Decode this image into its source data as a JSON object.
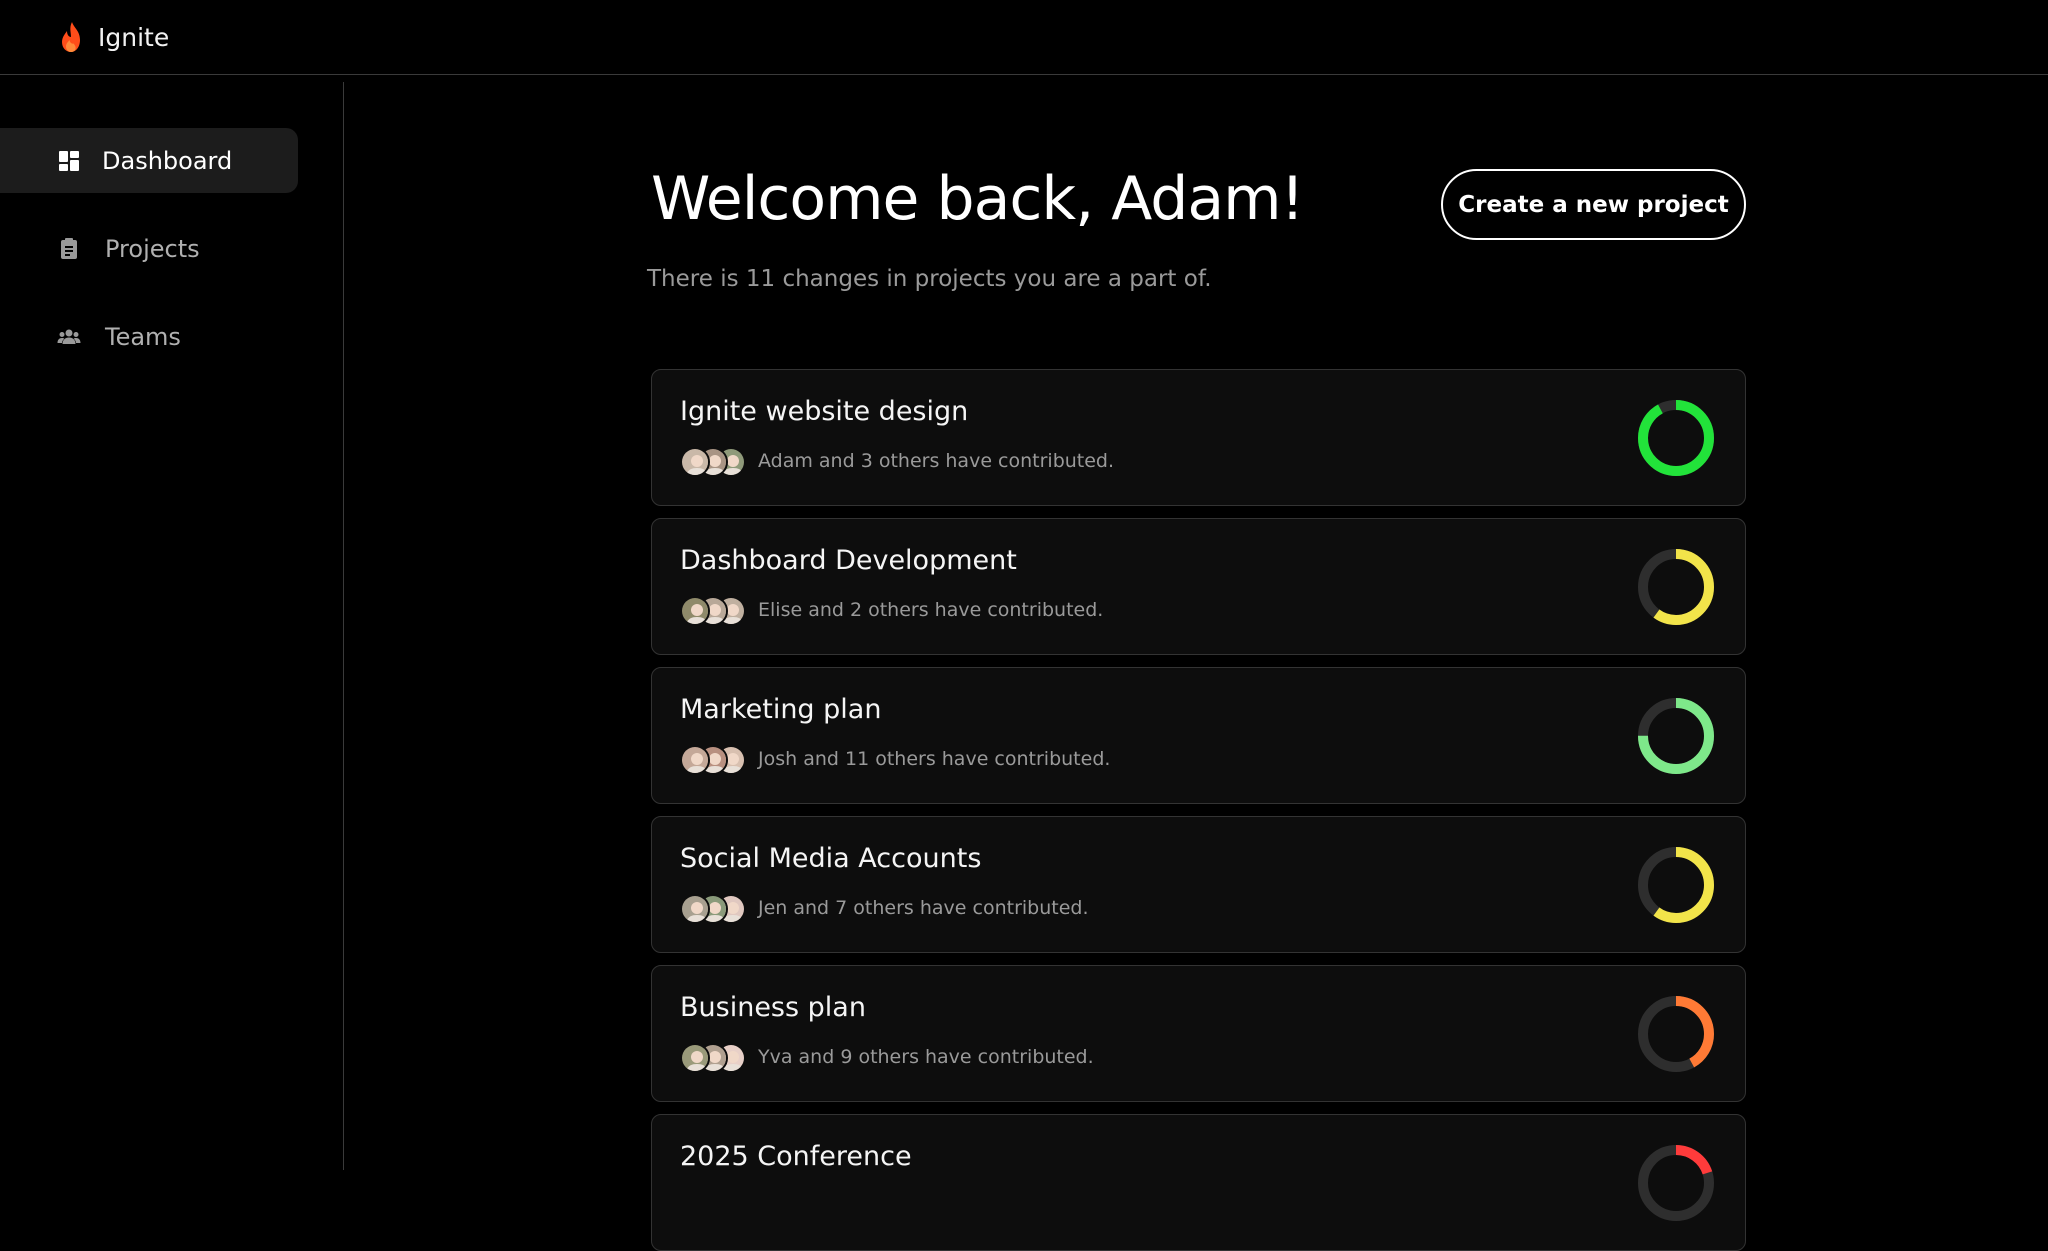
{
  "app": {
    "name": "Ignite",
    "brand_color": "#ff4d1a"
  },
  "sidebar": {
    "items": [
      {
        "label": "Dashboard",
        "icon": "dashboard-icon",
        "active": true
      },
      {
        "label": "Projects",
        "icon": "clipboard-icon",
        "active": false
      },
      {
        "label": "Teams",
        "icon": "users-icon",
        "active": false
      }
    ]
  },
  "main": {
    "welcome": "Welcome back, Adam!",
    "subtitle": "There is 11 changes in projects you are a part of.",
    "create_button": "Create a new project"
  },
  "projects": [
    {
      "title": "Ignite website design",
      "contributors": "Adam and 3 others have contributed.",
      "progress": 0.92,
      "color": "#22e33a"
    },
    {
      "title": "Dashboard Development",
      "contributors": "Elise and 2 others have contributed.",
      "progress": 0.6,
      "color": "#f2e44a"
    },
    {
      "title": "Marketing plan",
      "contributors": "Josh and 11 others have contributed.",
      "progress": 0.75,
      "color": "#7ee88a"
    },
    {
      "title": "Social Media Accounts",
      "contributors": "Jen and 7 others have contributed.",
      "progress": 0.6,
      "color": "#f2e44a"
    },
    {
      "title": "Business plan",
      "contributors": "Yva and 9 others have contributed.",
      "progress": 0.42,
      "color": "#ff7a35"
    },
    {
      "title": "2025 Conference",
      "contributors": "",
      "progress": 0.2,
      "color": "#ff3b3b"
    }
  ]
}
